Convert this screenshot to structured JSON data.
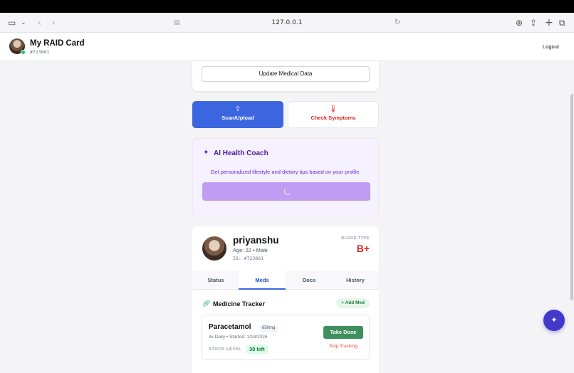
{
  "browser": {
    "url": "127.0.0.1",
    "icons": [
      "sidebar-icon",
      "chevron-down-icon",
      "back-icon",
      "forward-icon",
      "reader-icon",
      "reload-icon",
      "download-icon",
      "share-icon",
      "new-tab-icon",
      "tabs-overview-icon"
    ]
  },
  "header": {
    "title": "My RAID Card",
    "id": "#723861",
    "logout_label": "Logout"
  },
  "top_card": {
    "update_label": "Update Medical Data"
  },
  "actions": {
    "scan_label": "Scan/Upload",
    "check_label": "Check Symptoms"
  },
  "coach": {
    "title": "AI Health Coach",
    "description": "Get personalized lifestyle and dietary tips based on your profile.",
    "loading": true
  },
  "profile": {
    "name": "priyanshu",
    "age_gender": "Age: 22 • Male",
    "id": "ID: #723861",
    "blood_type_label": "BLOOD TYPE",
    "blood_type": "B+"
  },
  "tabs": [
    {
      "label": "Status",
      "active": false
    },
    {
      "label": "Meds",
      "active": true
    },
    {
      "label": "Docs",
      "active": false
    },
    {
      "label": "History",
      "active": false
    }
  ],
  "medicine": {
    "title": "Medicine Tracker",
    "add_label": "+ Add Med",
    "items": [
      {
        "name": "Paracetamol",
        "dose": "650mg",
        "schedule": "3x Daily • Started: 1/18/2026",
        "stock_label": "STOCK LEVEL",
        "stock": "30 left",
        "take_label": "Take Dose",
        "stop_label": "Stop Tracking"
      }
    ]
  },
  "colors": {
    "primary": "#3b66e0",
    "danger": "#dc2626",
    "success": "#3f8f5f",
    "coach_bg": "#f5f1ff",
    "fab": "#4338ca"
  }
}
